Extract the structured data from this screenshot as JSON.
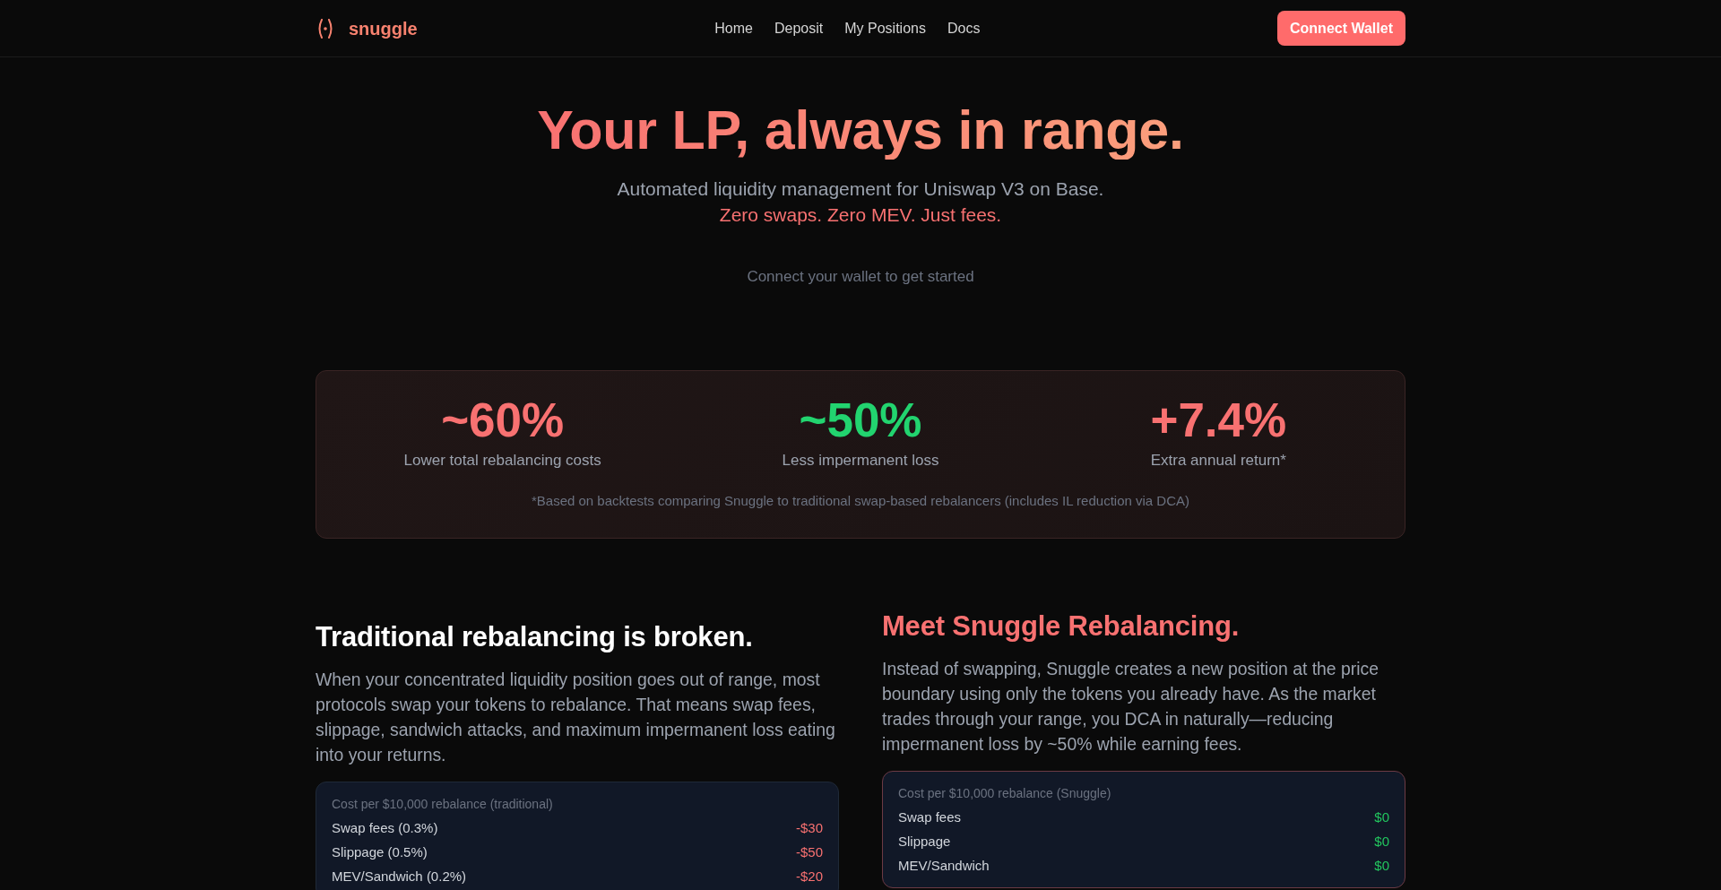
{
  "header": {
    "brand": "snuggle",
    "nav": [
      "Home",
      "Deposit",
      "My Positions",
      "Docs"
    ],
    "cta": "Connect Wallet"
  },
  "hero": {
    "title": "Your LP, always in range.",
    "subtitle": "Automated liquidity management for Uniswap V3 on Base.",
    "tagline": "Zero swaps. Zero MEV. Just fees.",
    "hint": "Connect your wallet to get started"
  },
  "stats": {
    "items": [
      {
        "value": "~60%",
        "label": "Lower total rebalancing costs",
        "color": "#f87171"
      },
      {
        "value": "~50%",
        "label": "Less impermanent loss",
        "color": "#22d46f"
      },
      {
        "value": "+7.4%",
        "label": "Extra annual return*",
        "color": "#f87171"
      }
    ],
    "footnote": "*Based on backtests comparing Snuggle to traditional swap-based rebalancers (includes IL reduction via DCA)"
  },
  "comparison": [
    {
      "kind": "problem",
      "heading": "Traditional rebalancing is broken.",
      "body": "When your concentrated liquidity position goes out of range, most protocols swap your tokens to rebalance. That means swap fees, slippage, sandwich attacks, and maximum impermanent loss eating into your returns.",
      "card": {
        "title": "Cost per $10,000 rebalance (traditional)",
        "rows": [
          {
            "label": "Swap fees (0.3%)",
            "value": "-$30"
          },
          {
            "label": "Slippage (0.5%)",
            "value": "-$50"
          },
          {
            "label": "MEV/Sandwich (0.2%)",
            "value": "-$20"
          }
        ]
      }
    },
    {
      "kind": "solution",
      "heading": "Meet Snuggle Rebalancing.",
      "body": "Instead of swapping, Snuggle creates a new position at the price boundary using only the tokens you already have. As the market trades through your range, you DCA in naturally—reducing impermanent loss by ~50% while earning fees.",
      "card": {
        "title": "Cost per $10,000 rebalance (Snuggle)",
        "rows": [
          {
            "label": "Swap fees",
            "value": "$0"
          },
          {
            "label": "Slippage",
            "value": "$0"
          },
          {
            "label": "MEV/Sandwich",
            "value": "$0"
          }
        ]
      }
    }
  ]
}
